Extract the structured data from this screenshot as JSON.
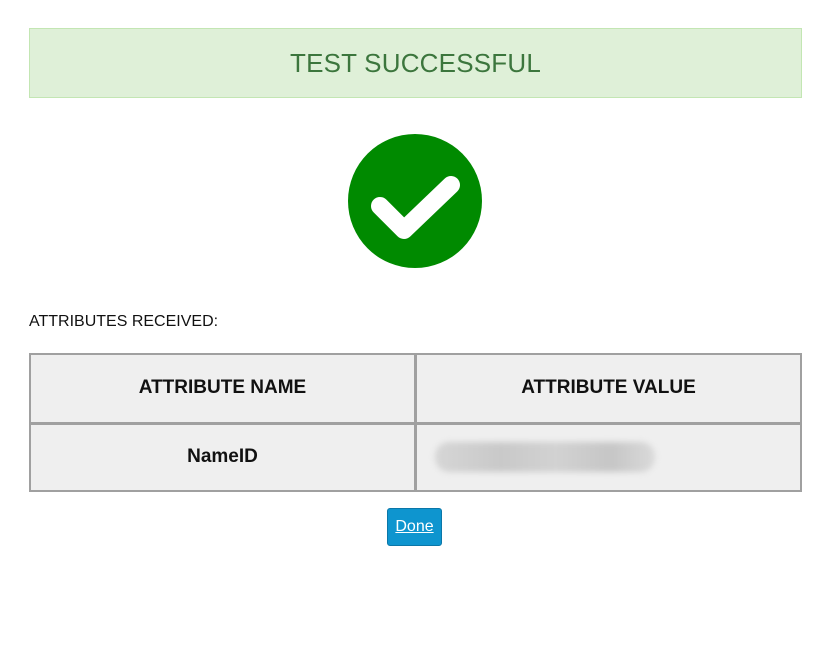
{
  "banner": {
    "text": "TEST SUCCESSFUL"
  },
  "status_icon": {
    "name": "check-circle-icon",
    "color": "#008a00"
  },
  "attributes": {
    "heading": "ATTRIBUTES RECEIVED:",
    "columns": [
      "ATTRIBUTE NAME",
      "ATTRIBUTE VALUE"
    ],
    "rows": [
      {
        "name": "NameID",
        "value_redacted": true
      }
    ]
  },
  "actions": {
    "done_label": "Done"
  },
  "colors": {
    "banner_bg": "#dff0d8",
    "banner_text": "#3c763d",
    "button_bg": "#0e95cf"
  }
}
